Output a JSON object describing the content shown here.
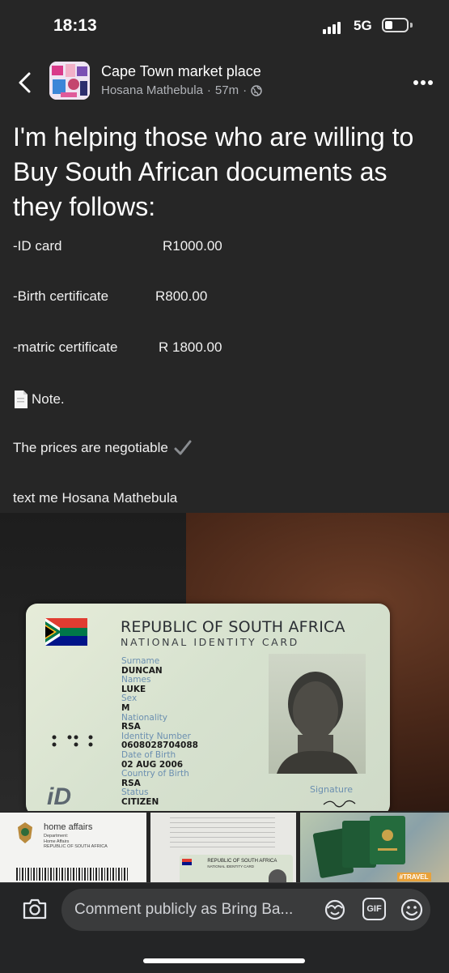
{
  "status": {
    "time": "18:13",
    "network": "5G"
  },
  "header": {
    "group_name": "Cape Town market place",
    "author": "Hosana Mathebula",
    "time": "57m",
    "icons": [
      "back-chevron-icon",
      "globe-icon",
      "more-dots-icon"
    ]
  },
  "post": {
    "headline": "I'm helping those who are willing to Buy South African documents as they follows:",
    "items": [
      {
        "name": "-ID card",
        "price": "R1000.00"
      },
      {
        "name": "-Birth certificate",
        "price": "R800.00"
      },
      {
        "name": "-matric certificate",
        "price": "R 1800.00"
      }
    ],
    "note": "Note.",
    "negotiable": "The prices are negotiable",
    "contact": "text me Hosana Mathebula"
  },
  "id_card": {
    "title": "REPUBLIC OF SOUTH AFRICA",
    "subtitle": "NATIONAL IDENTITY CARD",
    "surname_label": "Surname",
    "surname": "DUNCAN",
    "names_label": "Names",
    "names": "LUKE",
    "sex_label": "Sex",
    "sex": "M",
    "nationality_label": "Nationality",
    "nationality": "RSA",
    "id_label": "Identity Number",
    "id_number": "0608028704088",
    "dob_label": "Date of Birth",
    "dob": "02 AUG 2006",
    "cob_label": "Country of Birth",
    "cob": "RSA",
    "status_label": "Status",
    "status": "CITIZEN",
    "signature_label": "Signature",
    "logo": "iD"
  },
  "thumbnails": {
    "home_affairs": "home affairs",
    "dept_lines": [
      "Department:",
      "Home Affairs",
      "REPUBLIC OF SOUTH AFRICA"
    ],
    "smart_card_title": "REPUBLIC OF SOUTH AFRICA",
    "smart_card_sub": "NATIONAL IDENTITY CARD",
    "travel_tag": "#TRAVEL"
  },
  "comment": {
    "placeholder": "Comment publicly as Bring Ba...",
    "gif": "GIF",
    "icons": [
      "camera-icon",
      "avatar-sticker-icon",
      "gif-icon",
      "emoji-icon"
    ]
  },
  "colors": {
    "background": "#262626",
    "text": "#f2f2f2",
    "secondary": "#b0b3b8",
    "input": "#3a3b3c"
  }
}
